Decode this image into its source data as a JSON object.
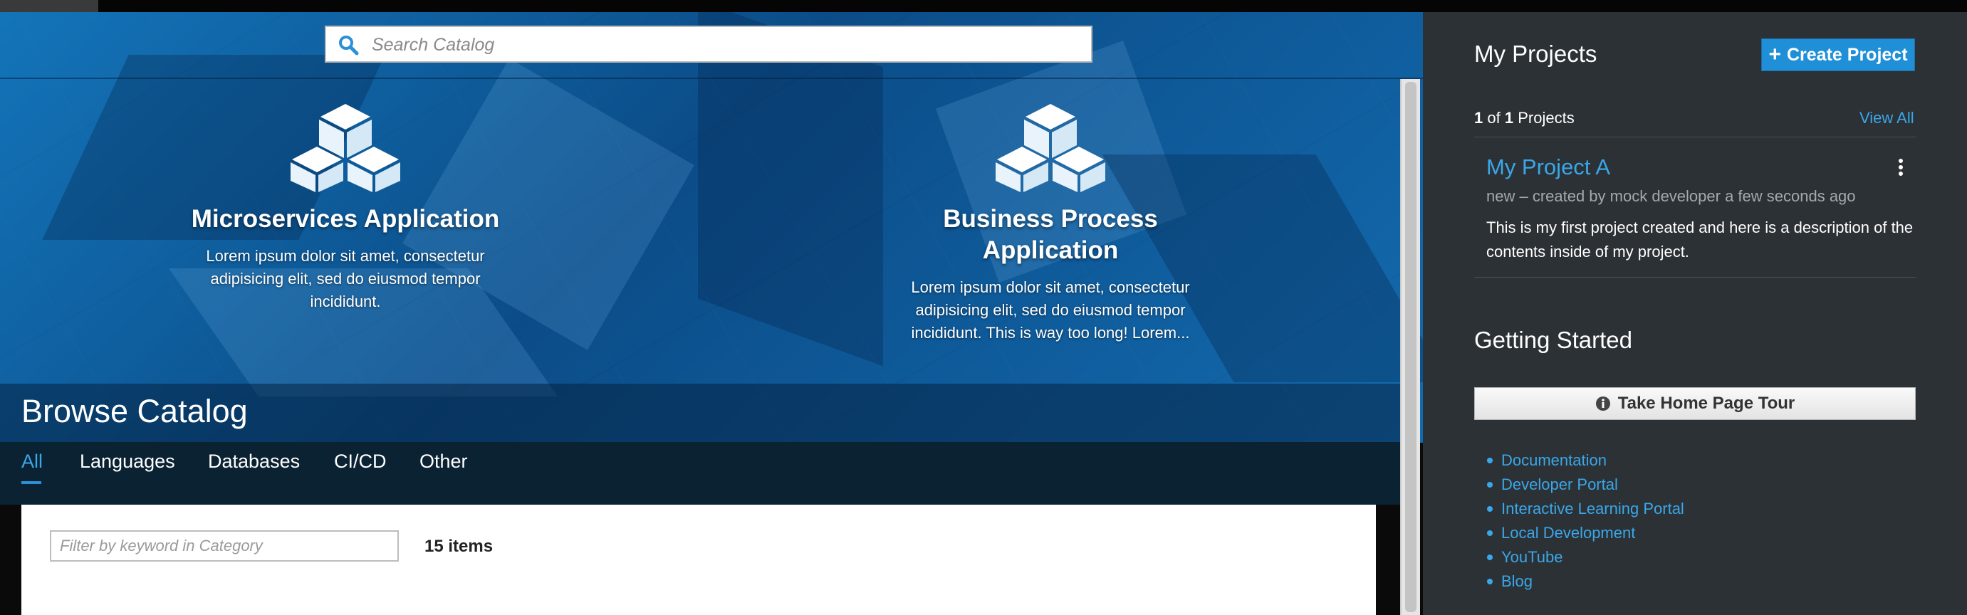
{
  "search": {
    "placeholder": "Search Catalog"
  },
  "features": [
    {
      "title": "Microservices Application",
      "description": "Lorem ipsum dolor sit amet, consectetur adipisicing elit, sed do eiusmod tempor incididunt."
    },
    {
      "title_line1": "Business Process",
      "title_line2": "Application",
      "description": "Lorem ipsum dolor sit amet, consectetur adipisicing elit, sed do eiusmod tempor incididunt. This is way too long! Lorem..."
    }
  ],
  "catalog": {
    "title": "Browse Catalog",
    "tabs": [
      "All",
      "Languages",
      "Databases",
      "CI/CD",
      "Other"
    ],
    "active_tab": "All",
    "filter_placeholder": "Filter by keyword in Category",
    "items_count": "15 items"
  },
  "projects": {
    "title": "My Projects",
    "create_label": "Create Project",
    "count_current": "1",
    "count_of": "of",
    "count_total": "1",
    "count_suffix": "Projects",
    "view_all_label": "View All",
    "items": [
      {
        "name": "My Project A",
        "meta": "new – created by mock developer a few seconds ago",
        "description": "This is my first project created and here is a description of the contents inside of my project."
      }
    ]
  },
  "getting_started": {
    "title": "Getting Started",
    "tour_label": "Take Home Page Tour",
    "links": [
      "Documentation",
      "Developer Portal",
      "Interactive Learning Portal",
      "Local Development",
      "YouTube",
      "Blog"
    ]
  },
  "colors": {
    "accent": "#3aa7e8",
    "button_primary": "#1f8fd8",
    "sidebar_bg": "#2c3136",
    "tabs_bg": "#0b2233"
  },
  "icons": {
    "search": "search-icon",
    "feature": "cubes-icon",
    "create": "plus-icon",
    "tour": "info-circle-icon",
    "kebab": "kebab-menu-icon"
  }
}
